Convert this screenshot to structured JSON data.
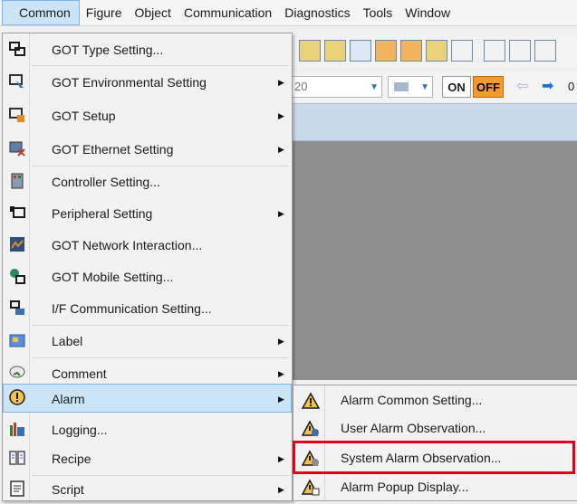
{
  "menubar": {
    "items": [
      "Common",
      "Figure",
      "Object",
      "Communication",
      "Diagnostics",
      "Tools",
      "Window"
    ]
  },
  "toolbar": {
    "zoom_value": "20",
    "on_label": "ON",
    "off_label": "OFF",
    "nav_value": "0"
  },
  "menu": {
    "items": [
      {
        "label": "GOT Type Setting...",
        "icon": "got-type-icon",
        "submenu": false
      },
      {
        "label": "GOT Environmental Setting",
        "icon": "environment-icon",
        "submenu": true
      },
      {
        "label": "GOT Setup",
        "icon": "setup-icon",
        "submenu": true
      },
      {
        "label": "GOT Ethernet Setting",
        "icon": "ethernet-icon",
        "submenu": true
      },
      {
        "label": "Controller Setting...",
        "icon": "controller-icon",
        "submenu": false
      },
      {
        "label": "Peripheral Setting",
        "icon": "peripheral-icon",
        "submenu": true
      },
      {
        "label": "GOT Network Interaction...",
        "icon": "network-icon",
        "submenu": false
      },
      {
        "label": "GOT Mobile Setting...",
        "icon": "mobile-icon",
        "submenu": false
      },
      {
        "label": "I/F Communication Setting...",
        "icon": "interface-icon",
        "submenu": false
      },
      {
        "label": "Label",
        "icon": "label-icon",
        "submenu": true
      },
      {
        "label": "Comment",
        "icon": "comment-icon",
        "submenu": true
      },
      {
        "label": "Alarm",
        "icon": "alarm-icon",
        "submenu": true,
        "highlighted": true
      },
      {
        "label": "Logging...",
        "icon": "logging-icon",
        "submenu": false
      },
      {
        "label": "Recipe",
        "icon": "recipe-icon",
        "submenu": true
      },
      {
        "label": "Script",
        "icon": "script-icon",
        "submenu": true
      }
    ]
  },
  "alarm_submenu": {
    "items": [
      {
        "label": "Alarm Common Setting...",
        "icon": "warning-icon"
      },
      {
        "label": "User Alarm Observation...",
        "icon": "user-alarm-icon"
      },
      {
        "label": "System Alarm Observation...",
        "icon": "system-alarm-icon",
        "highlighted": true
      },
      {
        "label": "Alarm Popup Display...",
        "icon": "alarm-popup-icon"
      }
    ]
  },
  "colors": {
    "highlight_bg": "#cce4f7",
    "highlight_border": "#7eb4ea",
    "red_box": "#e0001b",
    "off_button": "#f39b2c"
  }
}
